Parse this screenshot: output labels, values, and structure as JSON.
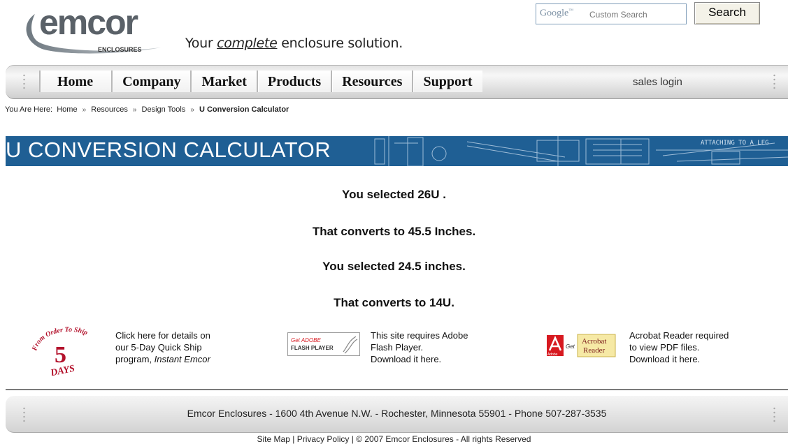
{
  "header": {
    "logo_text": "emcor",
    "logo_sub": "ENCLOSURES",
    "tagline_pre": "Your ",
    "tagline_em": "complete",
    "tagline_post": " enclosure solution."
  },
  "search": {
    "brand": "Google",
    "tm": "™",
    "placeholder": "Custom Search",
    "button_label": "Search"
  },
  "nav": {
    "tabs": [
      "Home",
      "Company",
      "Market",
      "Products",
      "Resources",
      "Support"
    ],
    "sales_login": "sales login"
  },
  "breadcrumb": {
    "prefix": "You Are Here:",
    "items": [
      "Home",
      "Resources",
      "Design Tools"
    ],
    "current": "U Conversion Calculator",
    "separator": "»"
  },
  "banner": {
    "title": "U CONVERSION CALCULATOR",
    "drawing_text": "ATTACHING TO A LEG"
  },
  "results": {
    "line1": "You selected 26U .",
    "line2": "That converts to 45.5 Inches.",
    "line3": "You selected 24.5 inches.",
    "line4": "That converts to 14U."
  },
  "promos": {
    "quickship": {
      "badge_arc": "From Order To Ship",
      "badge_num": "5",
      "badge_word": "DAYS",
      "line1": "Click here for details on",
      "line2": "our 5-Day Quick Ship",
      "line3_pre": "program, ",
      "line3_em": "Instant Emcor"
    },
    "flash": {
      "badge_get": "Get ADOBE",
      "badge_name": "FLASH PLAYER",
      "line1": "This site requires Adobe",
      "line2": "Flash Player.",
      "line3": "Download it here."
    },
    "acrobat": {
      "badge_adobe": "Adobe",
      "badge_get": "Get",
      "badge_name1": "Acrobat",
      "badge_name2": "Reader",
      "line1": "Acrobat Reader required",
      "line2": "to view PDF files.",
      "line3": "Download it here."
    }
  },
  "footer": {
    "address": "Emcor Enclosures - 1600 4th Avenue N.W. - Rochester, Minnesota 55901 - Phone 507-287-3535",
    "links": [
      "Site Map",
      "Privacy Policy"
    ],
    "copyright": "© 2007 Emcor Enclosures - All rights Reserved",
    "separator": "|"
  },
  "colors": {
    "banner_blue": "#1f5f94",
    "quickship_red": "#b3122c",
    "adobe_red": "#d71920"
  }
}
